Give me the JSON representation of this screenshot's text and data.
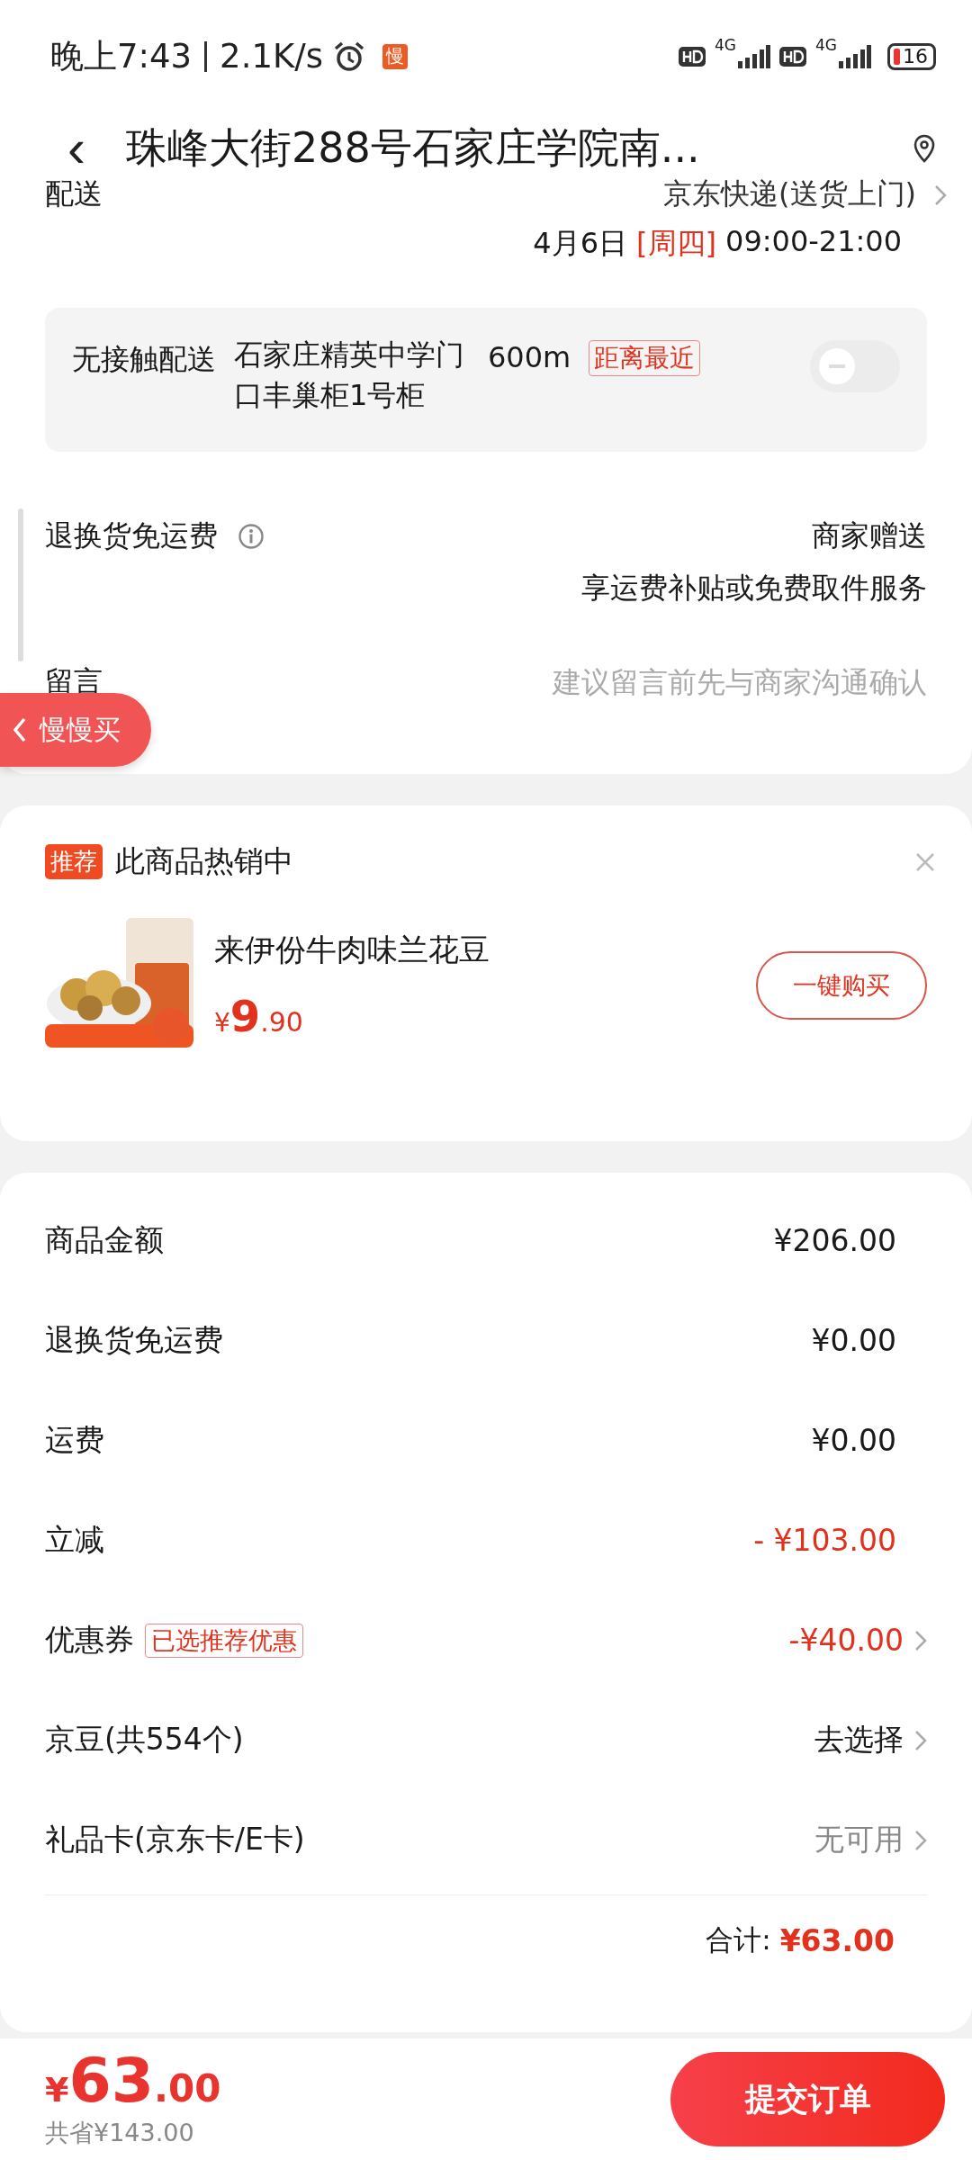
{
  "status_bar": {
    "time": "晚上7:43",
    "speed": "2.1K/s",
    "app_badge": "慢",
    "network_1": "4G",
    "network_2": "4G",
    "battery": "16"
  },
  "header": {
    "back": "‹",
    "title": "珠峰大街288号石家庄学院南..."
  },
  "delivery": {
    "label": "配送",
    "carrier": "京东快递(送货上门)",
    "date": "4月6日",
    "weekday": "[周四]",
    "time": "09:00-21:00"
  },
  "contactless": {
    "label": "无接触配送",
    "locker": "石家庄精英中学门口丰巢柜1号柜",
    "distance": "600m",
    "tag": "距离最近",
    "on": false
  },
  "return_shipping": {
    "label": "退换货免运费",
    "value": "商家赠送",
    "note": "享运费补贴或免费取件服务"
  },
  "message": {
    "label": "留言",
    "placeholder": "建议留言前先与商家沟通确认"
  },
  "floating_button": {
    "label": "慢慢买"
  },
  "recommend": {
    "tag": "推荐",
    "title": "此商品热销中",
    "product": {
      "kind": "picture",
      "name": "来伊份牛肉味兰花豆",
      "currency": "¥",
      "integer": "9",
      "decimal": ".90"
    },
    "button": "一键购买"
  },
  "summary": {
    "rows": [
      {
        "label": "商品金额",
        "value": "¥206.00",
        "color": "#1a1a1a",
        "chevron": false
      },
      {
        "label": "退换货免运费",
        "value": "¥0.00",
        "color": "#1a1a1a",
        "chevron": false
      },
      {
        "label": "运费",
        "value": "¥0.00",
        "color": "#1a1a1a",
        "chevron": false
      },
      {
        "label": "立减",
        "value": "- ¥103.00",
        "color": "#e2311d",
        "chevron": false
      },
      {
        "label": "优惠券",
        "tag": "已选推荐优惠",
        "value": "-¥40.00",
        "color": "#e2311d",
        "chevron": true
      },
      {
        "label": "京豆(共554个)",
        "value": "去选择",
        "color": "#1a1a1a",
        "chevron": true
      },
      {
        "label": "礼品卡(京东卡/E卡)",
        "value": "无可用",
        "color": "#888888",
        "chevron": true
      }
    ],
    "total_label": "合计:",
    "total": "¥63.00"
  },
  "bottom_bar": {
    "currency": "¥",
    "integer": "63",
    "decimal": ".00",
    "saved": "共省¥143.00",
    "submit": "提交订单"
  }
}
